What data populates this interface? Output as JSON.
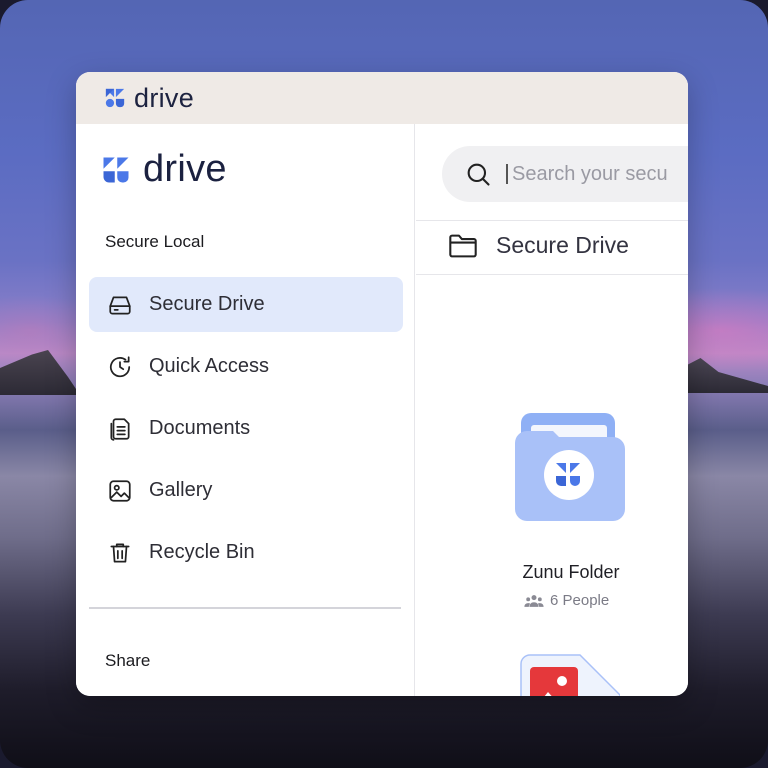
{
  "app": {
    "title_bar_brand": "drive",
    "sidebar_brand": "drive"
  },
  "sidebar": {
    "section_local": "Secure Local",
    "items": [
      {
        "label": "Secure Drive",
        "icon": "drive-icon",
        "active": true
      },
      {
        "label": "Quick Access",
        "icon": "clock-icon",
        "active": false
      },
      {
        "label": "Documents",
        "icon": "documents-icon",
        "active": false
      },
      {
        "label": "Gallery",
        "icon": "gallery-icon",
        "active": false
      },
      {
        "label": "Recycle Bin",
        "icon": "trash-icon",
        "active": false
      }
    ],
    "section_share": "Share"
  },
  "main": {
    "search": {
      "placeholder": "Search your secu"
    },
    "breadcrumb": "Secure Drive",
    "items": [
      {
        "type": "folder",
        "name": "Zunu Folder",
        "meta": "6 People"
      },
      {
        "type": "image-file"
      }
    ]
  },
  "colors": {
    "accent": "#4b78e8",
    "active_bg": "#e1e9fb",
    "folder": "#a9c1f8",
    "image_badge": "#e5383b"
  }
}
